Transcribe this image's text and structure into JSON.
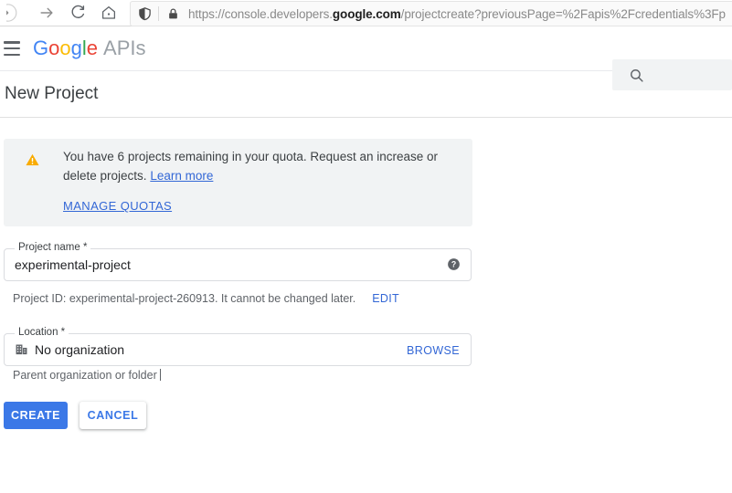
{
  "browser": {
    "nav": {
      "back_icon": "back-arrow-icon",
      "forward_icon": "forward-arrow-icon",
      "reload_icon": "reload-icon",
      "home_icon": "home-icon"
    },
    "url": {
      "scheme": "https://console.developers.",
      "host": "google.com",
      "path": "/projectcreate?previousPage=%2Fapis%2Fcredentials%3Fp",
      "shield_icon": "shield-icon",
      "lock_icon": "lock-icon"
    }
  },
  "header": {
    "menu_icon": "hamburger-menu-icon",
    "brand": {
      "g1": "G",
      "o1": "o",
      "o2": "o",
      "g2": "g",
      "l1": "l",
      "e1": "e",
      "suffix": "APIs"
    },
    "search": {
      "icon": "search-icon",
      "value": "",
      "placeholder": ""
    }
  },
  "page": {
    "title": "New Project"
  },
  "quota_banner": {
    "warning_icon": "warning-triangle-icon",
    "message": "You have 6 projects remaining in your quota. Request an increase or delete projects.",
    "learn_more": "Learn more",
    "manage_quotas": "MANAGE QUOTAS",
    "background_color": "#f1f3f4",
    "warning_color": "#f9ab00"
  },
  "form": {
    "project_name": {
      "label": "Project name *",
      "value": "experimental-project",
      "help_icon": "help-circle-icon"
    },
    "project_id": {
      "text": "Project ID: experimental-project-260913. It cannot be changed later.",
      "edit_label": "EDIT"
    },
    "location": {
      "label": "Location *",
      "icon": "organization-building-icon",
      "value": "No organization",
      "browse_label": "BROWSE",
      "helper_text": "Parent organization or folder"
    }
  },
  "actions": {
    "create_label": "CREATE",
    "cancel_label": "CANCEL",
    "primary_color": "#3b78e7",
    "link_color": "#3367d6"
  }
}
